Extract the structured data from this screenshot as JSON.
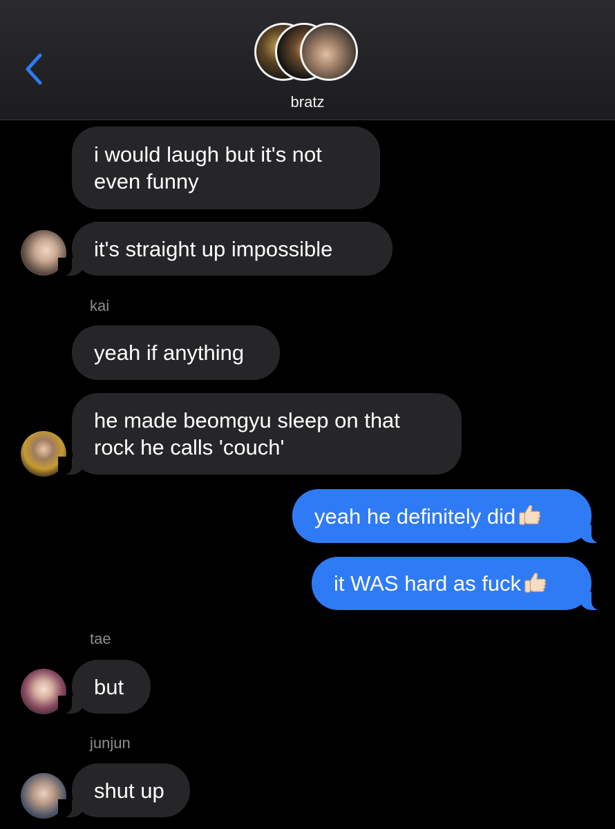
{
  "header": {
    "chat_name": "bratz",
    "back_icon": "chevron-left-icon",
    "accent_color": "#2f7bf6"
  },
  "messages": [
    {
      "text": "i would laugh but it's not\neven funny",
      "direction": "incoming"
    },
    {
      "text": "it's straight up impossible",
      "direction": "incoming"
    },
    {
      "sender": "kai"
    },
    {
      "text": "yeah if anything",
      "direction": "incoming"
    },
    {
      "text": "he made beomgyu sleep on that\nrock he calls 'couch'",
      "direction": "incoming"
    },
    {
      "text": "yeah he definitely did",
      "emoji": "thumbs-up-icon",
      "direction": "outgoing"
    },
    {
      "text": "it WAS hard as fuck",
      "emoji": "thumbs-up-icon",
      "direction": "outgoing"
    },
    {
      "sender": "tae"
    },
    {
      "text": "but",
      "direction": "incoming"
    },
    {
      "sender": "junjun"
    },
    {
      "text": "shut up",
      "direction": "incoming"
    }
  ]
}
